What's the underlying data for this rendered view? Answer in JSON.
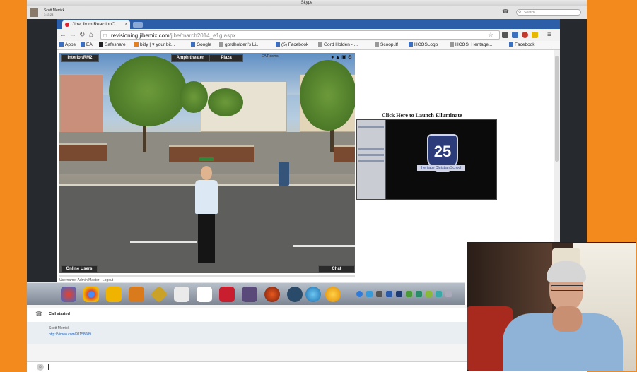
{
  "mac": {
    "title": "Skype"
  },
  "skype": {
    "user_name": "Scott Merrick",
    "user_status": "3:43:28",
    "search_placeholder": "Search"
  },
  "browser": {
    "tab_title": "Jibe, from ReactionC",
    "url_host": "revisioning.jibemix.com",
    "url_path": "/jibe/march2014_e1g.aspx",
    "bookmarks": [
      "Apps",
      "EA",
      "Safeshare",
      "bitly | ♥ your bit...",
      "Google",
      "gordholden's Li...",
      "(5) Facebook",
      "Gord Holden - ...",
      "Scoop.it!",
      "HCOSLogo",
      "HCOS: Heritage...",
      "Facebook"
    ],
    "colors": {
      "tabstrip": "#2c5fa8"
    }
  },
  "scene": {
    "btn_interior": "Interior/RM2",
    "btn_amphitheater": "Amphitheater",
    "btn_plaza": "Plaza",
    "top_small": "EA Rooms",
    "btn_online_users": "Online Users",
    "btn_chat": "Chat",
    "below_text": "Username: Admin Master - Logout"
  },
  "elluminate": {
    "launch_text": "Click Here to Launch Elluminate",
    "emblem_number": "25",
    "emblem_ribbon": "Heritage Christian School"
  },
  "dock_labels": {
    "caption": ""
  },
  "call": {
    "status": "Call started",
    "sender": "Scott Merrick",
    "link": "http://vimeo.com/91158089"
  },
  "icons": {
    "phone": "phone-icon",
    "search": "search-icon",
    "back": "back-arrow-icon",
    "forward": "forward-arrow-icon",
    "reload": "reload-icon",
    "home": "home-icon",
    "star": "star-icon",
    "emoji": "emoji-icon"
  }
}
